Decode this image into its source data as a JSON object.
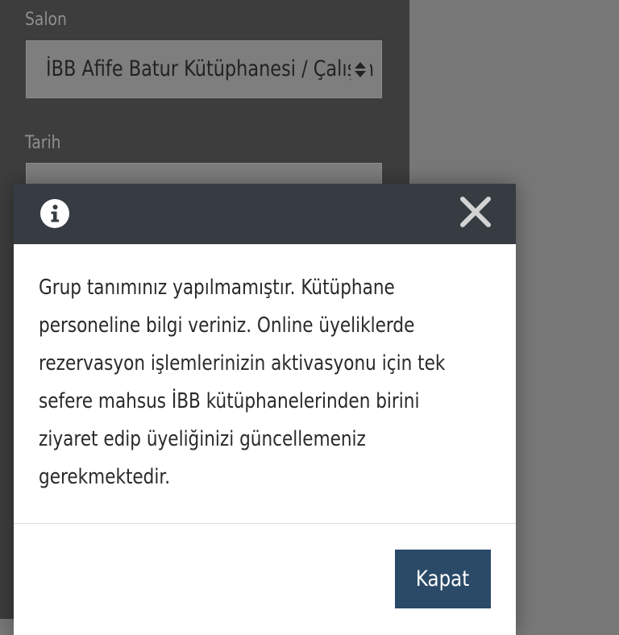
{
  "form": {
    "salon_label": "Salon",
    "salon_value": "İBB Afife Batur Kütüphanesi / Çalışma Salonu",
    "tarih_label": "Tarih"
  },
  "dialog": {
    "info_icon": "info-circle-icon",
    "close_icon": "close-x-icon",
    "message_lines": [
      "Grup tanımınız yapılmamıştır. Kütüphane",
      "personeline bilgi veriniz. Online üyeliklerde",
      "rezervasyon işlemlerinizin aktivasyonu için tek",
      "sefere mahsus İBB kütüphanelerinden birini",
      "ziyaret edip üyeliğinizi güncellemeniz",
      "gerekmektedir."
    ],
    "close_button_label": "Kapat"
  },
  "colors": {
    "header_bg": "#373c43",
    "button_bg": "#2a4a68",
    "overlay_bg": "#787878"
  }
}
